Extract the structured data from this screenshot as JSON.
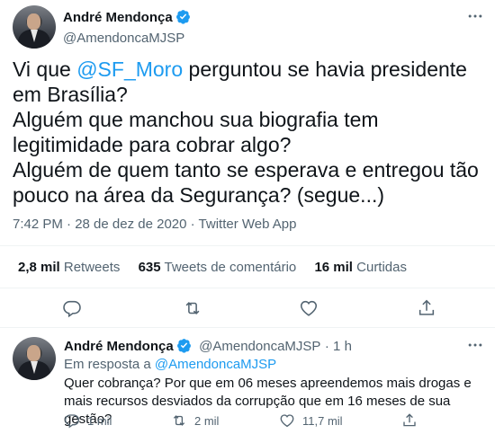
{
  "main_tweet": {
    "author_name": "André Mendonça",
    "author_handle": "@AmendoncaMJSP",
    "text_prefix": "Vi que ",
    "mention": "@SF_Moro",
    "text_rest": " perguntou se havia presidente em Brasília?\nAlguém que manchou sua biografia tem legitimidade para cobrar algo?\nAlguém de quem tanto se esperava e entregou tão pouco na área da Segurança? (segue...)",
    "timestamp": "7:42 PM · 28 de dez de 2020 · Twitter Web App",
    "stats": [
      {
        "value": "2,8 mil",
        "label": "Retweets"
      },
      {
        "value": "635",
        "label": "Tweets de comentário"
      },
      {
        "value": "16 mil",
        "label": "Curtidas"
      }
    ]
  },
  "reply_tweet": {
    "author_name": "André Mendonça",
    "author_handle": "@AmendoncaMJSP",
    "time": "· 1 h",
    "reply_prefix": "Em resposta a ",
    "reply_mention": "@AmendoncaMJSP",
    "text": "Quer cobrança? Por que em 06 meses apreendemos mais drogas e mais recursos desviados da corrupção que em 16 meses de sua gestão?",
    "counts": {
      "replies": "1 mil",
      "retweets": "2 mil",
      "likes": "11,7 mil"
    }
  },
  "icons": {
    "verified": "verified-badge-icon",
    "more": "more-dots-icon",
    "reply": "reply-icon",
    "retweet": "retweet-icon",
    "like": "heart-icon",
    "share": "share-icon"
  },
  "colors": {
    "accent": "#1d9bf0",
    "muted": "#536471",
    "text": "#0f1419",
    "divider": "#eff3f4"
  }
}
